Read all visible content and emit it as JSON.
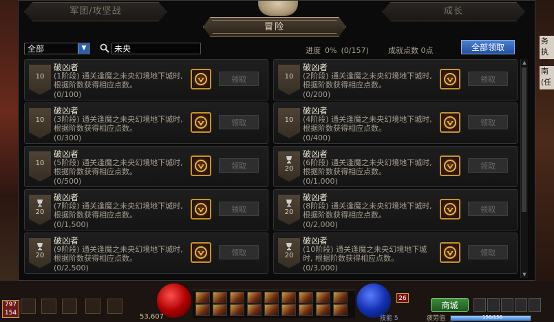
{
  "tabs": {
    "left": "军团/攻坚战",
    "right": "成长",
    "active": "冒险"
  },
  "filter": {
    "category": "全部",
    "search_value": "未央"
  },
  "stats": {
    "progress_label": "进度",
    "progress_percent": "0%",
    "progress_count": "(0/157)",
    "points": "成就点数 0点"
  },
  "claim_all_label": "全部领取",
  "achievements": [
    {
      "title": "破凶者",
      "desc": "(1阶段) 通关逢魔之未央幻境地下城时, 根据阶数获得相应点数。",
      "count": "(0/100)",
      "badge": "10",
      "trophy": false,
      "claim": "领取"
    },
    {
      "title": "破凶者",
      "desc": "(2阶段) 通关逢魔之未央幻境地下城时, 根据阶数获得相应点数。",
      "count": "(0/200)",
      "badge": "10",
      "trophy": false,
      "claim": "领取"
    },
    {
      "title": "破凶者",
      "desc": "(3阶段) 通关逢魔之未央幻境地下城时, 根据阶数获得相应点数。",
      "count": "(0/300)",
      "badge": "10",
      "trophy": false,
      "claim": "领取"
    },
    {
      "title": "破凶者",
      "desc": "(4阶段) 通关逢魔之未央幻境地下城时, 根据阶数获得相应点数。",
      "count": "(0/400)",
      "badge": "10",
      "trophy": false,
      "claim": "领取"
    },
    {
      "title": "破凶者",
      "desc": "(5阶段) 通关逢魔之未央幻境地下城时, 根据阶数获得相应点数。",
      "count": "(0/500)",
      "badge": "10",
      "trophy": false,
      "claim": "领取"
    },
    {
      "title": "破凶者",
      "desc": "(6阶段) 通关逢魔之未央幻境地下城时, 根据阶数获得相应点数。",
      "count": "(0/1,000)",
      "badge": "20",
      "trophy": true,
      "claim": "领取"
    },
    {
      "title": "破凶者",
      "desc": "(7阶段) 通关逢魔之未央幻境地下城时, 根据阶数获得相应点数。",
      "count": "(0/1,500)",
      "badge": "20",
      "trophy": true,
      "claim": "领取"
    },
    {
      "title": "破凶者",
      "desc": "(8阶段) 通关逢魔之未央幻境地下城时, 根据阶数获得相应点数。",
      "count": "(0/2,000)",
      "badge": "20",
      "trophy": true,
      "claim": "领取"
    },
    {
      "title": "破凶者",
      "desc": "(9阶段) 通关逢魔之未央幻境地下城时, 根据阶数获得相应点数。",
      "count": "(0/2,500)",
      "badge": "20",
      "trophy": true,
      "claim": "领取"
    },
    {
      "title": "破凶者",
      "desc": "(10阶段) 通关逢魔之未央幻境地下城时, 根据阶数获得相应点数。",
      "count": "(0/3,000)",
      "badge": "20",
      "trophy": true,
      "claim": "领取"
    }
  ],
  "side_fragments": [
    "务",
    "执行",
    "南",
    "(任"
  ],
  "hud": {
    "level": "797",
    "level_sub": "154",
    "gold": "53,607",
    "skill_points": "技能 5",
    "fatigue_label": "疲劳值",
    "fatigue_value": "156/156",
    "shop_label": "商城",
    "notice_count": "26"
  },
  "colors": {
    "accent_blue": "#2f5ea8",
    "gold_border": "#c7952f"
  }
}
